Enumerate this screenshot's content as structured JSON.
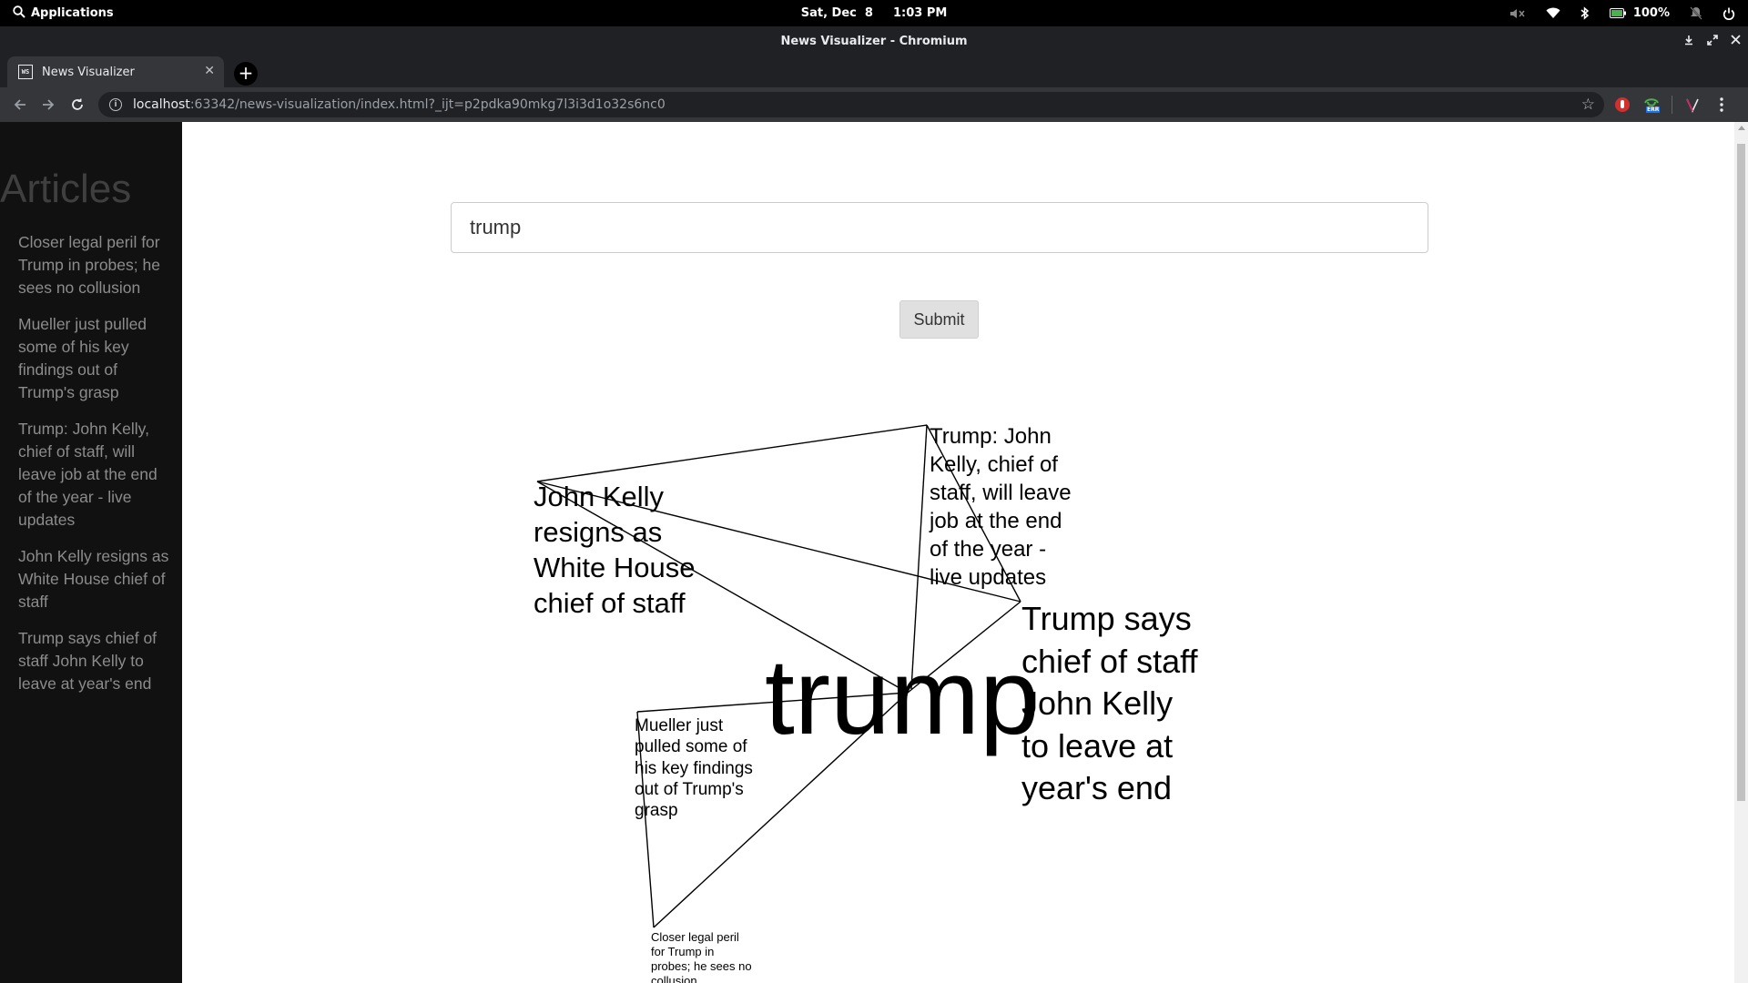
{
  "desktop": {
    "applications_label": "Applications",
    "date": "Sat, Dec  8",
    "time": "1:03 PM",
    "battery_label": "100%"
  },
  "window": {
    "title": "News Visualizer - Chromium"
  },
  "browser": {
    "tab_title": "News Visualizer",
    "tab_favicon_text": "WS",
    "url_host": "localhost",
    "url_path": ":63342/news-visualization/index.html?_ijt=p2pdka90mkg7l3i3d1o32s6nc0",
    "extension_badge": "ERR"
  },
  "page": {
    "sidebar_title": "Articles",
    "articles": [
      "Closer legal peril for Trump in probes; he sees no collusion",
      "Mueller just pulled some of his key findings out of Trump's grasp",
      "Trump: John Kelly, chief of staff, will leave job at the end of the year - live updates",
      "John Kelly resigns as White House chief of staff",
      "Trump says chief of staff John Kelly to leave at year's end"
    ],
    "search_value": "trump",
    "submit_label": "Submit",
    "graph": {
      "center_word": "trump",
      "nodes": [
        {
          "lines": [
            "John Kelly",
            "resigns as",
            "White House",
            "chief of staff"
          ]
        },
        {
          "lines": [
            "Trump: John",
            "Kelly, chief of",
            "staff, will leave",
            "job at the end",
            "of the year -",
            "live updates"
          ]
        },
        {
          "lines": [
            "Trump says",
            "chief of staff",
            "John Kelly",
            "to leave at",
            "year's end"
          ]
        },
        {
          "lines": [
            "Mueller just",
            "pulled some of",
            "his key findings",
            "out of Trump's",
            "grasp"
          ]
        },
        {
          "lines": [
            "Closer legal peril",
            "for Trump in",
            "probes; he sees no",
            "collusion"
          ]
        }
      ]
    }
  },
  "colors": {
    "sidebar_bg": "#111111",
    "sidebar_link": "#8c8c8c",
    "browser_frame": "#202124",
    "graph_stroke": "#000000"
  },
  "icons": [
    "search-icon",
    "volume-muted-icon",
    "wifi-icon",
    "bluetooth-icon",
    "battery-icon",
    "notifications-off-icon",
    "power-icon",
    "download-icon",
    "restore-icon",
    "close-icon",
    "back-icon",
    "forward-icon",
    "reload-icon",
    "info-icon",
    "star-icon",
    "menu-icon"
  ]
}
